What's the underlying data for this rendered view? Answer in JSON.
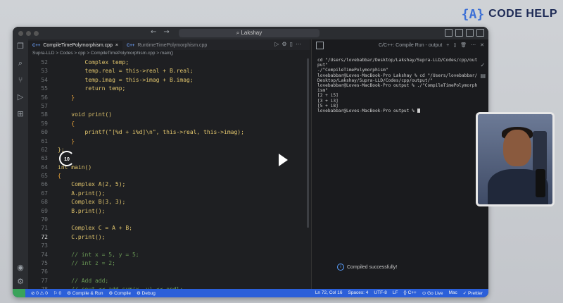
{
  "brand": {
    "logo_glyph": "{A}",
    "name": "CODE HELP"
  },
  "window": {
    "search_placeholder": "Lakshay",
    "tabs": [
      {
        "label": "CompileTimePolymorphism.cpp",
        "icon_label": "C++",
        "active": true,
        "close": "×"
      },
      {
        "label": "RuntimeTimePolymorphism.cpp",
        "icon_label": "C++",
        "active": false
      }
    ],
    "breadcrumb": "Supra-LLD > Codes > cpp > CompileTimePolymorphism.cpp > main()"
  },
  "code_lines": [
    {
      "n": "52",
      "text": "        Complex temp;",
      "kind": ""
    },
    {
      "n": "53",
      "text": "        temp.real = this->real + B.real;",
      "kind": ""
    },
    {
      "n": "54",
      "text": "        temp.imag = this->imag + B.imag;",
      "kind": ""
    },
    {
      "n": "55",
      "text": "        return temp;",
      "kind": ""
    },
    {
      "n": "56",
      "text": "    }",
      "kind": "br"
    },
    {
      "n": "57",
      "text": "",
      "kind": ""
    },
    {
      "n": "58",
      "text": "    void print()",
      "kind": ""
    },
    {
      "n": "59",
      "text": "    {",
      "kind": "br"
    },
    {
      "n": "60",
      "text": "        printf(\"[%d + i%d]\\n\", this->real, this->imag);",
      "kind": ""
    },
    {
      "n": "61",
      "text": "    }",
      "kind": "br"
    },
    {
      "n": "62",
      "text": "};",
      "kind": ""
    },
    {
      "n": "63",
      "text": "",
      "kind": ""
    },
    {
      "n": "64",
      "text": "int main()",
      "kind": ""
    },
    {
      "n": "65",
      "text": "{",
      "kind": "br"
    },
    {
      "n": "66",
      "text": "    Complex A(2, 5);",
      "kind": ""
    },
    {
      "n": "67",
      "text": "    A.print();",
      "kind": ""
    },
    {
      "n": "68",
      "text": "    Complex B(3, 3);",
      "kind": ""
    },
    {
      "n": "69",
      "text": "    B.print();",
      "kind": ""
    },
    {
      "n": "70",
      "text": "",
      "kind": ""
    },
    {
      "n": "71",
      "text": "    Complex C = A + B;",
      "kind": ""
    },
    {
      "n": "72",
      "text": "    C.print();",
      "kind": ""
    },
    {
      "n": "73",
      "text": "",
      "kind": ""
    },
    {
      "n": "74",
      "text": "    // int x = 5, y = 5;",
      "kind": "cm"
    },
    {
      "n": "75",
      "text": "    // int z = 2;",
      "kind": "cm"
    },
    {
      "n": "76",
      "text": "",
      "kind": ""
    },
    {
      "n": "77",
      "text": "    // Add add;",
      "kind": "cm"
    },
    {
      "n": "78",
      "text": "    // cout << add.sum(x, y) << endl;",
      "kind": "cm"
    }
  ],
  "panel": {
    "title": "C/C++: Compile Run - output"
  },
  "terminal_lines": [
    "cd \"/Users/lovebabbar/Desktop/Lakshay/Supra-LLD/Codes/cpp/out",
    "put\"",
    "./\"CompileTimePolymorphism\"",
    "lovebabbar@Loves-MacBook-Pro Lakshay % cd \"/Users/lovebabbar/",
    "Desktop/Lakshay/Supra-LLD/Codes/cpp/output/\"",
    "lovebabbar@Loves-MacBook-Pro output % ./\"CompileTimePolymorph",
    "ism\"",
    "[2 + i5]",
    "[3 + i3]",
    "[5 + i8]",
    "lovebabbar@Loves-MacBook-Pro output % "
  ],
  "notification": "Compiled successfully!",
  "statusbar": {
    "left": [
      "⊘ 0 ⚠ 0",
      "⚐ 0",
      "⚙ Compile & Run",
      "⚙ Compile",
      "⚙ Debug"
    ],
    "right": [
      "Ln 72, Col 16",
      "Spaces: 4",
      "UTF-8",
      "LF",
      "{} C++",
      "⊙ Go Live",
      "Mac",
      "✓ Prettier"
    ]
  },
  "video": {
    "replay_label": "10"
  }
}
